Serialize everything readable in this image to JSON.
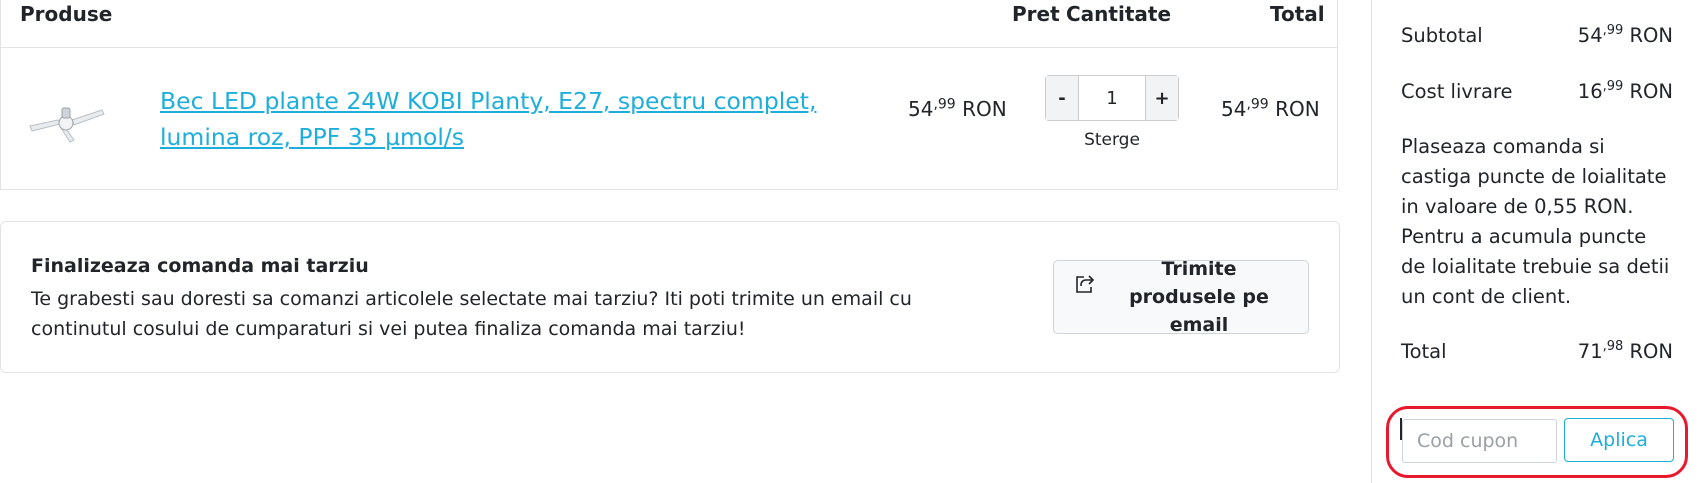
{
  "table": {
    "headers": {
      "products": "Produse",
      "price": "Pret",
      "quantity": "Cantitate",
      "total": "Total"
    },
    "item": {
      "name": "Bec LED plante 24W KOBI Planty, E27, spectru complet, lumina roz, PPF 35 µmol/s",
      "image_icon": "led-grow-bulb-image",
      "price_int": "54",
      "price_dec": ",99",
      "price_cur": " RON",
      "quantity": "1",
      "qty_minus": "-",
      "qty_plus": "+",
      "remove": "Sterge",
      "total_int": "54",
      "total_dec": ",99",
      "total_cur": " RON"
    }
  },
  "later": {
    "title": "Finalizeaza comanda mai tarziu",
    "text": "Te grabesti sau doresti sa comanzi articolele selectate mai tarziu? Iti poti trimite un email cu continutul cosului de cumparaturi si vei putea finaliza comanda mai tarziu!",
    "button_label": "Trimite produsele pe email",
    "button_icon": "share-icon"
  },
  "summary": {
    "subtotal_label": "Subtotal",
    "subtotal_int": "54",
    "subtotal_dec": ",99",
    "subtotal_cur": " RON",
    "shipping_label": "Cost livrare",
    "shipping_int": "16",
    "shipping_dec": ",99",
    "shipping_cur": " RON",
    "loyalty_text": "Plaseaza comanda si castiga puncte de loialitate in valoare de 0,55 RON. Pentru a acumula puncte de loialitate trebuie sa detii un cont de client.",
    "total_label": "Total",
    "total_int": "71",
    "total_dec": ",98",
    "total_cur": " RON"
  },
  "coupon": {
    "placeholder": "Cod cupon",
    "apply_label": "Aplica",
    "highlight_color": "#e8192c"
  },
  "colors": {
    "link": "#1eaedb",
    "border": "#e3e3e3"
  }
}
